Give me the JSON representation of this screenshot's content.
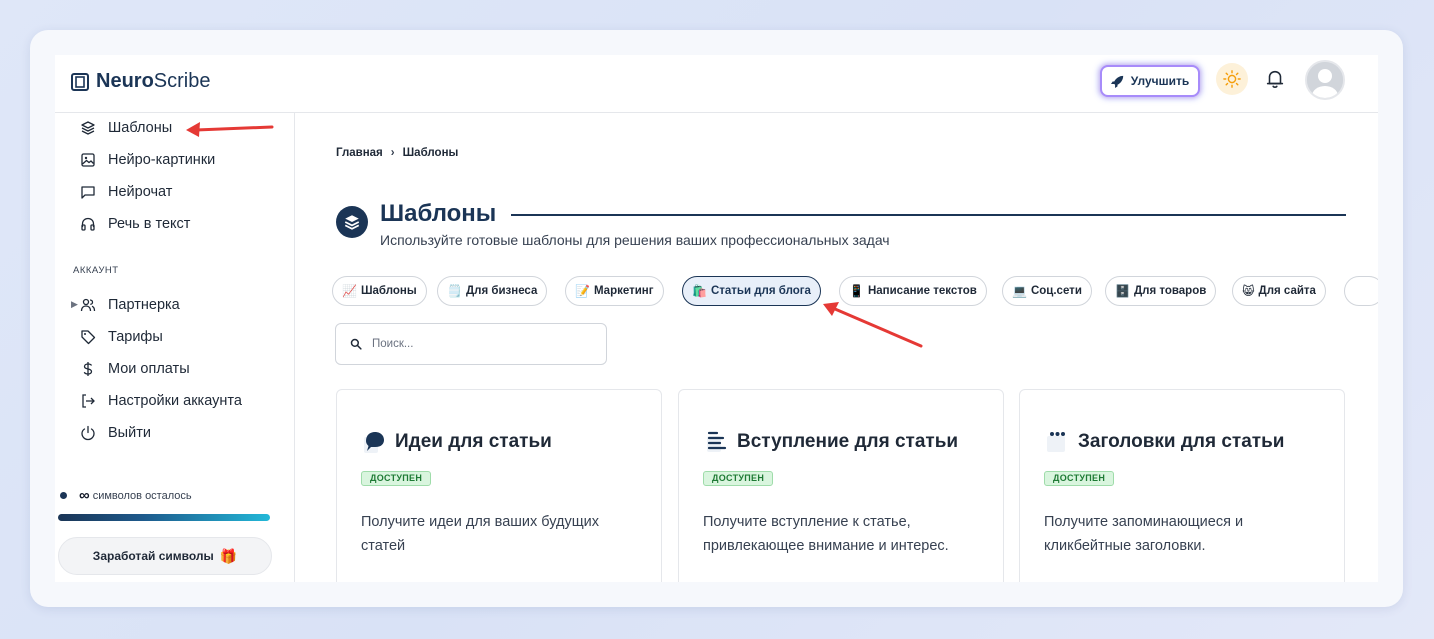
{
  "app": {
    "logo_bold": "Neuro",
    "logo_light": "Scribe"
  },
  "header": {
    "upgrade_label": "Улучшить"
  },
  "sidebar": {
    "items": [
      {
        "label": "Шаблоны",
        "icon": "layers-icon"
      },
      {
        "label": "Нейро-картинки",
        "icon": "image-icon"
      },
      {
        "label": "Нейрочат",
        "icon": "chat-icon"
      },
      {
        "label": "Речь в текст",
        "icon": "headphones-icon"
      }
    ],
    "section_account": "АККАУНТ",
    "account_items": [
      {
        "label": "Партнерка",
        "icon": "users-icon"
      },
      {
        "label": "Тарифы",
        "icon": "tag-icon"
      },
      {
        "label": "Мои оплаты",
        "icon": "dollar-icon"
      },
      {
        "label": "Настройки аккаунта",
        "icon": "login-icon"
      },
      {
        "label": "Выйти",
        "icon": "power-icon"
      }
    ],
    "credits_symbol": "∞",
    "credits_text": "символов осталось",
    "earn_label": "Заработай символы",
    "earn_icon": "🎁"
  },
  "main": {
    "breadcrumb": {
      "home": "Главная",
      "sep": "›",
      "current": "Шаблоны"
    },
    "title": "Шаблоны",
    "subtitle": "Используйте готовые шаблоны для решения ваших профессиональных задач",
    "search_placeholder": "Поиск...",
    "chips": [
      {
        "icon": "📈",
        "label": "Шаблоны"
      },
      {
        "icon": "🗒️",
        "label": "Для бизнеса"
      },
      {
        "icon": "📝",
        "label": "Маркетинг"
      },
      {
        "icon": "🛍️",
        "label": "Статьи для блога"
      },
      {
        "icon": "📱",
        "label": "Написание текстов"
      },
      {
        "icon": "💻",
        "label": "Соц.сети"
      },
      {
        "icon": "🗄️",
        "label": "Для товаров"
      },
      {
        "icon": "😸",
        "label": "Для сайта"
      }
    ],
    "cards": [
      {
        "title": "Идеи для статьи",
        "badge": "ДОСТУПЕН",
        "desc": "Получите идеи для ваших будущих статей"
      },
      {
        "title": "Вступление для статьи",
        "badge": "ДОСТУПЕН",
        "desc": "Получите вступление к статье, привлекающее внимание и интерес."
      },
      {
        "title": "Заголовки для статьи",
        "badge": "ДОСТУПЕН",
        "desc": "Получите запоминающиеся и кликбейтные заголовки."
      }
    ]
  },
  "colors": {
    "primary": "#1b3556",
    "badge_bg": "#d9f5de",
    "badge_text": "#1e7a34",
    "annotation": "#e53935"
  }
}
